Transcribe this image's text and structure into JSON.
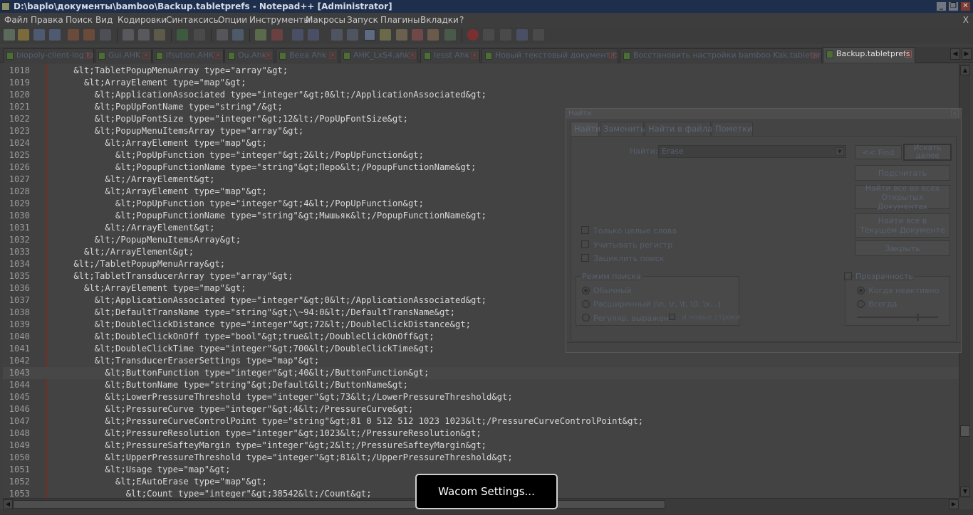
{
  "window": {
    "title": "D:\\baplo\\документы\\bamboo\\Backup.tabletprefs - Notepad++ [Administrator]",
    "controls": [
      "_",
      "❐",
      "✕"
    ]
  },
  "menu": {
    "items": [
      "Файл",
      "Правка",
      "Поиск",
      "Вид",
      "Кодировки",
      "Синтаксисы",
      "Опции",
      "Инструменты",
      "Макросы",
      "Запуск",
      "Плагины",
      "Вкладки",
      "?"
    ],
    "close": "X"
  },
  "tabs": [
    {
      "label": "biopoly-client-log.txt",
      "active": false
    },
    {
      "label": "Gui.AHK",
      "active": false
    },
    {
      "label": "ifsution.AHK",
      "active": false
    },
    {
      "label": "Ou.Ahk",
      "active": false
    },
    {
      "label": "Beea Ahk",
      "active": false
    },
    {
      "label": "AHK_LxS4.ahk",
      "active": false
    },
    {
      "label": "Iesst Ahk",
      "active": false
    },
    {
      "label": "Новый текстовый документ.txt",
      "active": false
    },
    {
      "label": "Восстановить настройки bamboo Kak.tabletprefs",
      "active": false
    },
    {
      "label": "Backup.tabletprefs",
      "active": true
    }
  ],
  "editor": {
    "current_line": 1043,
    "lines": [
      {
        "n": "1018",
        "text": "    &lt;TabletPopupMenuArray type=\"array\"&gt;"
      },
      {
        "n": "1019",
        "text": "      &lt;ArrayElement type=\"map\"&gt;"
      },
      {
        "n": "1020",
        "text": "        &lt;ApplicationAssociated type=\"integer\"&gt;0&lt;/ApplicationAssociated&gt;"
      },
      {
        "n": "1021",
        "text": "        &lt;PopUpFontName type=\"string\"/&gt;"
      },
      {
        "n": "1022",
        "text": "        &lt;PopUpFontSize type=\"integer\"&gt;12&lt;/PopUpFontSize&gt;"
      },
      {
        "n": "1023",
        "text": "        &lt;PopupMenuItemsArray type=\"array\"&gt;"
      },
      {
        "n": "1024",
        "text": "          &lt;ArrayElement type=\"map\"&gt;"
      },
      {
        "n": "1025",
        "text": "            &lt;PopUpFunction type=\"integer\"&gt;2&lt;/PopUpFunction&gt;"
      },
      {
        "n": "1026",
        "text": "            &lt;PopupFunctionName type=\"string\"&gt;Перо&lt;/PopupFunctionName&gt;"
      },
      {
        "n": "1027",
        "text": "          &lt;/ArrayElement&gt;"
      },
      {
        "n": "1028",
        "text": "          &lt;ArrayElement type=\"map\"&gt;"
      },
      {
        "n": "1029",
        "text": "            &lt;PopUpFunction type=\"integer\"&gt;4&lt;/PopUpFunction&gt;"
      },
      {
        "n": "1030",
        "text": "            &lt;PopupFunctionName type=\"string\"&gt;Мышьяк&lt;/PopupFunctionName&gt;"
      },
      {
        "n": "1031",
        "text": "          &lt;/ArrayElement&gt;"
      },
      {
        "n": "1032",
        "text": "        &lt;/PopupMenuItemsArray&gt;"
      },
      {
        "n": "1033",
        "text": "      &lt;/ArrayElement&gt;"
      },
      {
        "n": "1034",
        "text": "    &lt;/TabletPopupMenuArray&gt;"
      },
      {
        "n": "1035",
        "text": "    &lt;TabletTransducerArray type=\"array\"&gt;"
      },
      {
        "n": "1036",
        "text": "      &lt;ArrayElement type=\"map\"&gt;"
      },
      {
        "n": "1037",
        "text": "        &lt;ApplicationAssociated type=\"integer\"&gt;0&lt;/ApplicationAssociated&gt;"
      },
      {
        "n": "1038",
        "text": "        &lt;DefaultTransName type=\"string\"&gt;\\~94:0&lt;/DefaultTransName&gt;"
      },
      {
        "n": "1039",
        "text": "        &lt;DoubleClickDistance type=\"integer\"&gt;72&lt;/DoubleClickDistance&gt;"
      },
      {
        "n": "1040",
        "text": "        &lt;DoubleClickOnOff type=\"bool\"&gt;true&lt;/DoubleClickOnOff&gt;"
      },
      {
        "n": "1041",
        "text": "        &lt;DoubleClickTime type=\"integer\"&gt;700&lt;/DoubleClickTime&gt;"
      },
      {
        "n": "1042",
        "text": "        &lt;TransducerEraserSettings type=\"map\"&gt;"
      },
      {
        "n": "1043",
        "text": "          &lt;ButtonFunction type=\"integer\"&gt;40&lt;/ButtonFunction&gt;"
      },
      {
        "n": "1044",
        "text": "          &lt;ButtonName type=\"string\"&gt;Default&lt;/ButtonName&gt;"
      },
      {
        "n": "1045",
        "text": "          &lt;LowerPressureThreshold type=\"integer\"&gt;73&lt;/LowerPressureThreshold&gt;"
      },
      {
        "n": "1046",
        "text": "          &lt;PressureCurve type=\"integer\"&gt;4&lt;/PressureCurve&gt;"
      },
      {
        "n": "1047",
        "text": "          &lt;PressureCurveControlPoint type=\"string\"&gt;81 0 512 512 1023 1023&lt;/PressureCurveControlPoint&gt;"
      },
      {
        "n": "1048",
        "text": "          &lt;PressureResolution type=\"integer\"&gt;1023&lt;/PressureResolution&gt;"
      },
      {
        "n": "1049",
        "text": "          &lt;PressureSafteyMargin type=\"integer\"&gt;2&lt;/PressureSafteyMargin&gt;"
      },
      {
        "n": "1050",
        "text": "          &lt;UpperPressureThreshold type=\"integer\"&gt;81&lt;/UpperPressureThreshold&gt;"
      },
      {
        "n": "1051",
        "text": "          &lt;Usage type=\"map\"&gt;"
      },
      {
        "n": "1052",
        "text": "            &lt;EAutoErase type=\"map\"&gt;"
      },
      {
        "n": "1053",
        "text": "              &lt;Count type=\"integer\"&gt;38542&lt;/Count&gt;"
      }
    ]
  },
  "find_dialog": {
    "title": "Найти",
    "close": "×",
    "tabs": [
      "Найти",
      "Заменить",
      "Найти в файлах",
      "Пометки"
    ],
    "find_label": "Найти:",
    "find_value": "Erase",
    "buttons": {
      "find_prev": "<< Find",
      "find_next": "Искать далее",
      "count": "Подсчитать",
      "find_all_open": "Найти все во всех\nОткрытых Документах",
      "find_all_current": "Найти все в\nТекущем Документе",
      "close": "Закрыть"
    },
    "options": {
      "whole_words": "Только целые слова",
      "match_case": "Учитывать регистр",
      "wrap": "Зациклить поиск"
    },
    "search_mode": {
      "title": "Режим поиска",
      "normal": "Обычный",
      "extended": "Расширенный (\\n, \\r, \\t, \\0, \\x...)",
      "regex": "Регуляр. выражен.",
      "newline": ". и новые строки"
    },
    "transparency": {
      "title": "Прозрачность",
      "on_lose_focus": "Когда неактивно",
      "always": "Всегда"
    }
  },
  "osd": {
    "text": "Wacom Settings..."
  }
}
